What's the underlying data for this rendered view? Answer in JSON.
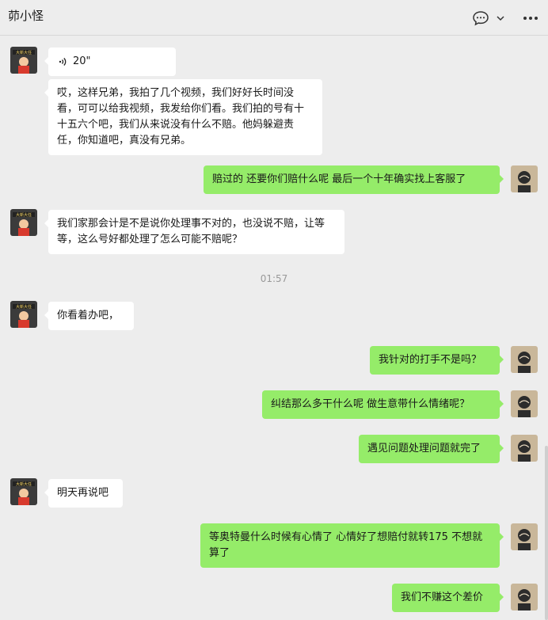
{
  "header": {
    "title": "茆小怪",
    "icons": [
      "chat-bubble-icon",
      "chevron-down-icon",
      "more-icon"
    ]
  },
  "messages": [
    {
      "side": "left",
      "type": "voice",
      "duration": "20\""
    },
    {
      "side": "left",
      "type": "text",
      "text": "哎，这样兄弟，我拍了几个视频，我们好好长时间没看，可可以给我视频，我发给你们看。我们拍的号有十十五六个吧，我们从来说没有什么不赔。他妈躲避责任，你知道吧，真没有兄弟。"
    },
    {
      "side": "right",
      "type": "text",
      "text": "赔过的 还要你们赔什么呢  最后一个十年确实找上客服了"
    },
    {
      "side": "left",
      "type": "text",
      "text": "我们家那会计是不是说你处理事不对的，也没说不赔，让等等，这么号好都处理了怎么可能不赔呢？"
    },
    {
      "type": "time",
      "text": "01:57"
    },
    {
      "side": "left",
      "type": "text",
      "text": "你看着办吧，"
    },
    {
      "side": "right",
      "type": "text",
      "text": "我针对的打手不是吗？"
    },
    {
      "side": "right",
      "type": "text",
      "text": "纠结那么多干什么呢  做生意带什么情绪呢？"
    },
    {
      "side": "right",
      "type": "text",
      "text": "遇见问题处理问题就完了"
    },
    {
      "side": "left",
      "type": "text",
      "text": "明天再说吧"
    },
    {
      "side": "right",
      "type": "text",
      "text": "等奥特曼什么时候有心情了   心情好了想赔付就转175  不想就算了"
    },
    {
      "side": "right",
      "type": "text",
      "text": "我们不赚这个差价"
    }
  ],
  "colors": {
    "background": "#ededed",
    "bubble_self": "#95ec69",
    "bubble_other": "#ffffff",
    "timestamp": "#999999"
  }
}
